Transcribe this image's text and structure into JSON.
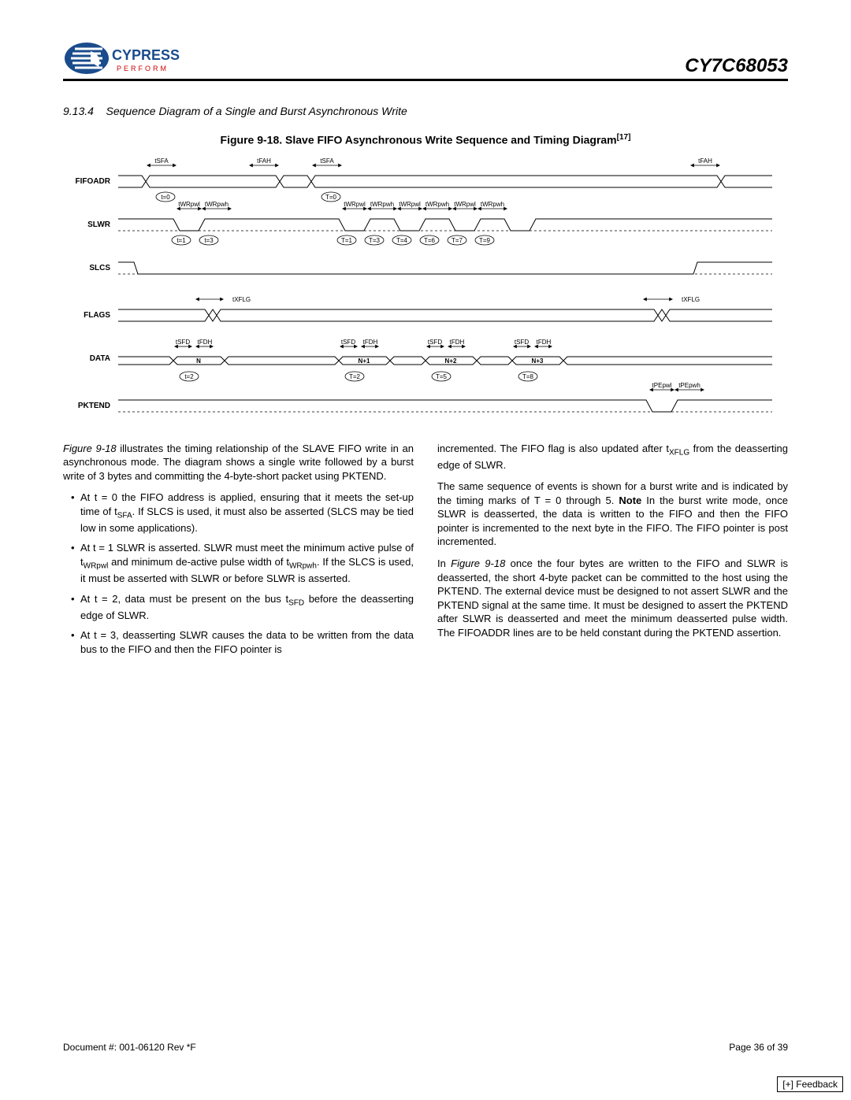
{
  "header": {
    "company": "CYPRESS",
    "tagline": "PERFORM",
    "part_number": "CY7C68053"
  },
  "section": {
    "number": "9.13.4",
    "title": "Sequence Diagram of a Single and Burst Asynchronous Write"
  },
  "figure": {
    "label": "Figure 9-18. Slave FIFO Asynchronous Write Sequence and Timing Diagram",
    "ref": "[17]"
  },
  "timing": {
    "signals": [
      "FIFOADR",
      "SLWR",
      "SLCS",
      "FLAGS",
      "DATA",
      "PKTEND"
    ],
    "labels": {
      "tSFA": "tSFA",
      "tFAH": "tFAH",
      "tWRpwl": "tWRpwl",
      "tWRpwh": "tWRpwh",
      "tXFLG": "tXFLG",
      "tSFD": "tSFD",
      "tFDH": "tFDH",
      "tPEpwl": "tPEpwl",
      "tPEpwh": "tPEpwh"
    },
    "time_markers_top": [
      "t=0",
      "T=0"
    ],
    "time_markers_slwr": [
      "t=1",
      "t=3",
      "T=1",
      "T=3",
      "T=4",
      "T=6",
      "T=7",
      "T=9"
    ],
    "time_markers_data": [
      "t=2",
      "T=2",
      "T=5",
      "T=8"
    ],
    "data_values": [
      "N",
      "N+1",
      "N+2",
      "N+3"
    ]
  },
  "text": {
    "p1a": "Figure 9-18",
    "p1b": " illustrates the timing relationship of the SLAVE FIFO write in an asynchronous mode. The diagram shows a single write followed by a burst write of 3 bytes and committing the 4-byte-short packet using PKTEND.",
    "b1": "At  t = 0 the FIFO address is applied, ensuring that it meets the set-up time of t",
    "b1sub": "SFA",
    "b1c": ". If SLCS is used, it must also be asserted (SLCS may be tied low in some applications).",
    "b2": "At  t = 1 SLWR is asserted. SLWR must meet the minimum active pulse of t",
    "b2sub": "WRpwl",
    "b2c": " and minimum de-active pulse width of t",
    "b2sub2": "WRpwh",
    "b2d": ". If the SLCS is used, it must be asserted with SLWR or before SLWR is asserted.",
    "b3": "At  t = 2, data must be present on the bus t",
    "b3sub": "SFD",
    "b3c": " before the deasserting edge of SLWR.",
    "b4": "At  t = 3, deasserting SLWR causes the data to be written from the data bus to the FIFO and then the FIFO pointer is",
    "p2": "incremented. The FIFO flag is also updated after t",
    "p2sub": "XFLG",
    "p2c": " from the deasserting edge of SLWR.",
    "p3a": "The same sequence of events is shown for a burst write and is indicated by the timing marks of T = 0 through 5. ",
    "p3note": "Note",
    "p3b": " In the burst write mode, once SLWR is deasserted, the data is written to the FIFO and then the FIFO pointer is incremented to the next byte in the FIFO. The FIFO pointer is post incremented.",
    "p4a": "In ",
    "p4fig": "Figure 9-18",
    "p4b": " once the four bytes are written to the FIFO and SLWR is deasserted, the short 4-byte packet can be committed to the host using the PKTEND. The external device must be designed to not assert SLWR and the PKTEND signal at the same time. It must be designed to assert the PKTEND after SLWR is deasserted and meet the minimum deasserted pulse width. The FIFOADDR lines are to be held constant during the PKTEND assertion."
  },
  "footer": {
    "doc": "Document #: 001-06120 Rev *F",
    "page": "Page 36 of 39",
    "feedback": "[+] Feedback"
  }
}
